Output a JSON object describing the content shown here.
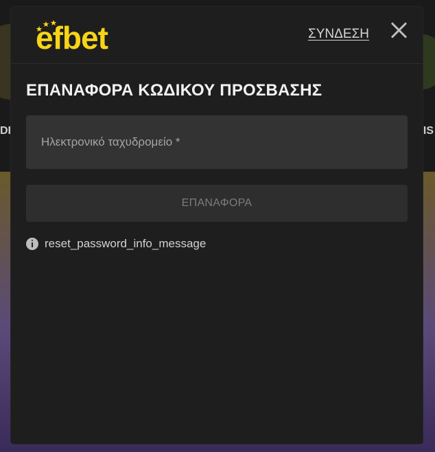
{
  "background": {
    "left_text": "DF",
    "right_text": "IS"
  },
  "header": {
    "logo_text": "efbet",
    "login_label": "ΣΥΝΔΕΣΗ"
  },
  "form": {
    "title": "ΕΠΑΝΑΦΟΡΑ ΚΩΔΙΚΟΥ ΠΡΟΣΒΑΣΗΣ",
    "email_placeholder": "Ηλεκτρονικό ταχυδρομείο *",
    "email_value": "",
    "reset_button_label": "ΕΠΑΝΑΦΟΡΑ",
    "info_message": "reset_password_info_message"
  },
  "colors": {
    "brand_yellow": "#f7d417",
    "modal_bg": "#1e1e1e",
    "field_bg": "#333333"
  }
}
